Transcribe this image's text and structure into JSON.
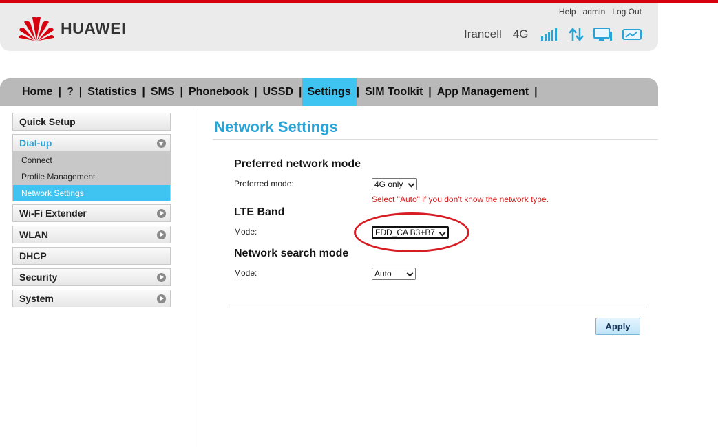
{
  "brand": {
    "name": "HUAWEI"
  },
  "top_links": {
    "help": "Help",
    "user": "admin",
    "logout": "Log Out"
  },
  "status": {
    "carrier": "Irancell",
    "network": "4G"
  },
  "nav": {
    "items": [
      "Home",
      "?",
      "Statistics",
      "SMS",
      "Phonebook",
      "USSD",
      "Settings",
      "SIM Toolkit",
      "App Management"
    ],
    "active": "Settings",
    "separator": "|"
  },
  "sidebar": {
    "quick_setup": "Quick Setup",
    "dialup": "Dial-up",
    "dialup_items": [
      "Connect",
      "Profile Management",
      "Network Settings"
    ],
    "wifi_extender": "Wi-Fi Extender",
    "wlan": "WLAN",
    "dhcp": "DHCP",
    "security": "Security",
    "system": "System"
  },
  "main": {
    "title": "Network Settings",
    "pref_section": "Preferred network mode",
    "pref_label": "Preferred mode:",
    "pref_value": "4G only",
    "pref_hint": "Select \"Auto\" if you don't know the network type.",
    "lte_section": "LTE Band",
    "lte_label": "Mode:",
    "lte_value": "FDD_CA B3+B7",
    "search_section": "Network search mode",
    "search_label": "Mode:",
    "search_value": "Auto",
    "apply_label": "Apply"
  },
  "colors": {
    "accent": "#3fc4f1",
    "title": "#2aa4d6",
    "brand_red": "#d7000f",
    "annotation": "#d81c24"
  }
}
